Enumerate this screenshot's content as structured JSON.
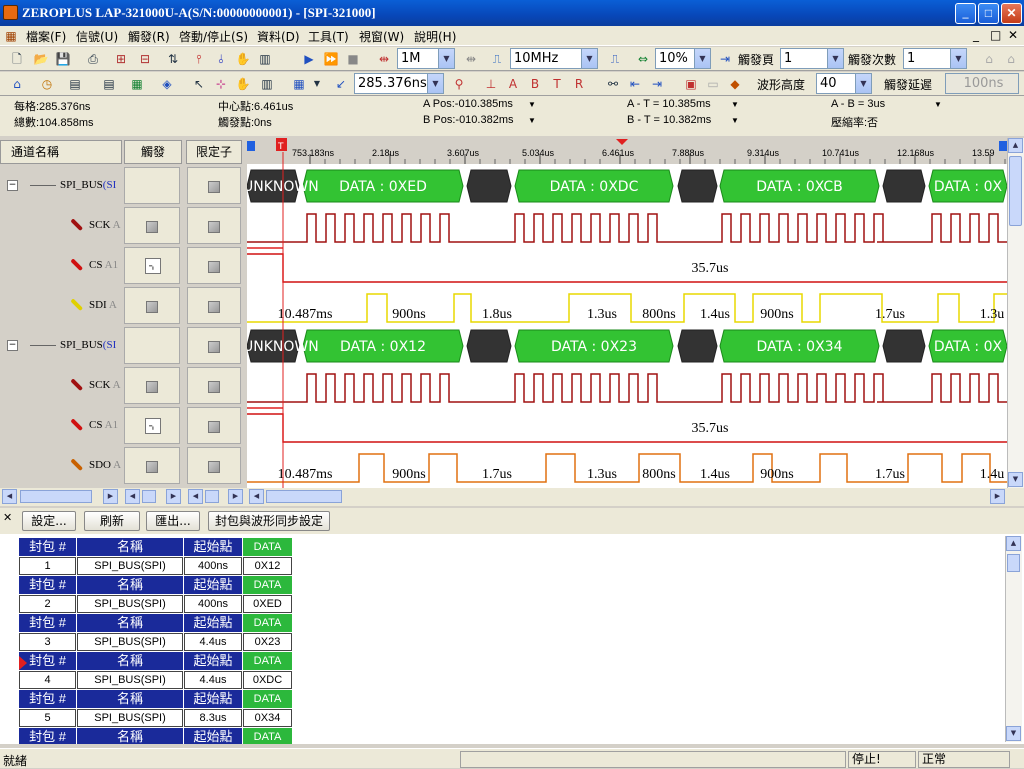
{
  "window": {
    "title": "ZEROPLUS LAP-321000U-A(S/N:00000000001) - [SPI-321000]",
    "buttons": {
      "minimize": "_",
      "maximize": "□",
      "close": "✕"
    }
  },
  "menubar": {
    "items": [
      "檔案(F)",
      "信號(U)",
      "觸發(R)",
      "啓動/停止(S)",
      "資料(D)",
      "工具(T)",
      "視窗(W)",
      "說明(H)"
    ],
    "mdi_buttons": [
      "_",
      "□",
      "✕"
    ]
  },
  "toolbar1": {
    "sample_depth": "1M",
    "sample_rate": "10MHz",
    "zoom_ratio": "10%",
    "trigger_page_label": "觸發頁",
    "trigger_page": "1",
    "trigger_count_label": "觸發次數",
    "trigger_count": "1"
  },
  "toolbar2": {
    "time_value": "285.376ns",
    "wave_height_label": "波形高度",
    "wave_height": "40",
    "trigger_delay_label": "觸發延遲",
    "trigger_delay": "100ns"
  },
  "info": {
    "per_div": "每格:285.376ns",
    "total": "總數:104.858ms",
    "center": "中心點:6.461us",
    "trigger_point": "觸發點:0ns",
    "a_pos": "A Pos:-010.385ms",
    "b_pos": "B Pos:-010.382ms",
    "a_t": "A - T = 10.385ms",
    "b_t": "B - T = 10.382ms",
    "a_b": "A - B = 3us",
    "compression": "壓縮率:否"
  },
  "channel_header": {
    "name": "通道名稱",
    "trigger": "觸發",
    "qualifier": "限定子"
  },
  "channels": [
    {
      "name": "SPI_BUS",
      "suffix": "(SI",
      "type": "bus"
    },
    {
      "name": "SCK",
      "suffix": "A",
      "type": "signal",
      "color": "#a01010"
    },
    {
      "name": "CS",
      "suffix": "A1",
      "type": "signal",
      "color": "#d01010"
    },
    {
      "name": "SDI",
      "suffix": "A",
      "type": "signal",
      "color": "#e0d000"
    },
    {
      "name": "SPI_BUS",
      "suffix": "(SI",
      "type": "bus"
    },
    {
      "name": "SCK",
      "suffix": "A",
      "type": "signal",
      "color": "#a01010"
    },
    {
      "name": "CS",
      "suffix": "A1",
      "type": "signal",
      "color": "#d01010"
    },
    {
      "name": "SDO",
      "suffix": "A",
      "type": "signal",
      "color": "#c86000"
    }
  ],
  "timescale": {
    "ticks": [
      "753.183ns",
      "2.18us",
      "3.607us",
      "5.034us",
      "6.461us",
      "7.888us",
      "9.314us",
      "10.741us",
      "12.168us",
      "13.59"
    ]
  },
  "bus1": {
    "unknown": "UNKNOWN",
    "packets": [
      "DATA : 0XED",
      "DATA : 0XDC",
      "DATA : 0XCB",
      "DATA : 0X"
    ]
  },
  "bus2": {
    "unknown": "UNKNOWN",
    "packets": [
      "DATA : 0X12",
      "DATA : 0X23",
      "DATA : 0X34",
      "DATA : 0X"
    ]
  },
  "cs_label_1": "35.7us",
  "cs_label_2": "35.7us",
  "sdi_labels": [
    "10.487ms",
    "900ns",
    "1.8us",
    "1.3us",
    "800ns",
    "1.4us",
    "900ns",
    "1.7us",
    "1.3u"
  ],
  "sdo_labels": [
    "10.487ms",
    "900ns",
    "1.7us",
    "1.3us",
    "800ns",
    "1.4us",
    "900ns",
    "1.7us",
    "1.4u"
  ],
  "panel_buttons": {
    "settings": "設定...",
    "refresh": "刷新",
    "export": "匯出...",
    "sync": "封包與波形同步設定"
  },
  "packet_table": {
    "headers": {
      "index": "封包 #",
      "name": "名稱",
      "start": "起始點",
      "data": "DATA"
    },
    "rows": [
      {
        "index": "1",
        "name": "SPI_BUS(SPI)",
        "start": "400ns",
        "data": "0X12"
      },
      {
        "index": "2",
        "name": "SPI_BUS(SPI)",
        "start": "400ns",
        "data": "0XED"
      },
      {
        "index": "3",
        "name": "SPI_BUS(SPI)",
        "start": "4.4us",
        "data": "0X23"
      },
      {
        "index": "4",
        "name": "SPI_BUS(SPI)",
        "start": "4.4us",
        "data": "0XDC"
      },
      {
        "index": "5",
        "name": "SPI_BUS(SPI)",
        "start": "8.3us",
        "data": "0X34"
      },
      {
        "index": "",
        "name": "",
        "start": "",
        "data": ""
      }
    ]
  },
  "statusbar": {
    "left": "就緒",
    "state": "停止!",
    "mode": "正常"
  }
}
